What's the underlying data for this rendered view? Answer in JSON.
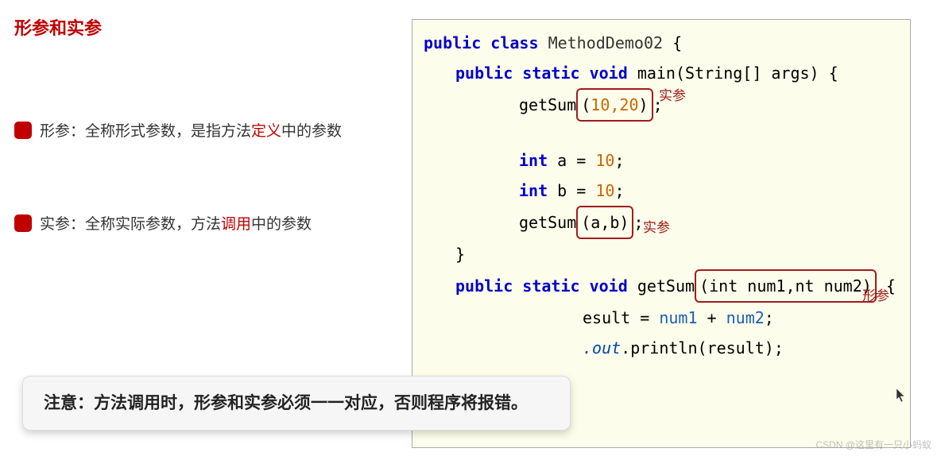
{
  "title": "形参和实参",
  "bullets": {
    "xingcan": {
      "prefix": "形参：全称形式参数，是指方法",
      "hl": "定义",
      "suffix": "中的参数"
    },
    "shican": {
      "prefix": "实参：全称实际参数，方法",
      "hl": "调用",
      "suffix": "中的参数"
    }
  },
  "code": {
    "kw_public": "public",
    "kw_class": "class",
    "cls_name": "MethodDemo02",
    "brace_open": "{",
    "brace_close": "}",
    "kw_static": "static",
    "kw_void": "void",
    "method_main": "main",
    "main_args": "(String[] args)",
    "call_getsum": "getSum",
    "args_literal_open": "(",
    "args_literal_inner": "10,20",
    "args_literal_close": ")",
    "semicolon": ";",
    "kw_int": "int",
    "var_a": "a",
    "eq": "=",
    "val_10a": "10",
    "var_b": "b",
    "val_10b": "10",
    "args_vars_open": "(",
    "args_vars_inner": "a,b",
    "args_vars_close": ")",
    "method_getsum": "getSum",
    "params_open": "(",
    "params_inner": "int num1,nt num2",
    "params_close": ")",
    "result_frag": "esult = ",
    "num1": "num1",
    "plus": " + ",
    "num2": "num2",
    "sys_out_frag": ".out",
    "println": ".println(result);"
  },
  "annotations": {
    "annot1": "实参",
    "annot2": "实参",
    "annot3": "形参"
  },
  "callout": "注意：方法调用时，形参和实参必须一一对应，否则程序将报错。",
  "watermark": "CSDN @这里有一只小蚂蚁"
}
